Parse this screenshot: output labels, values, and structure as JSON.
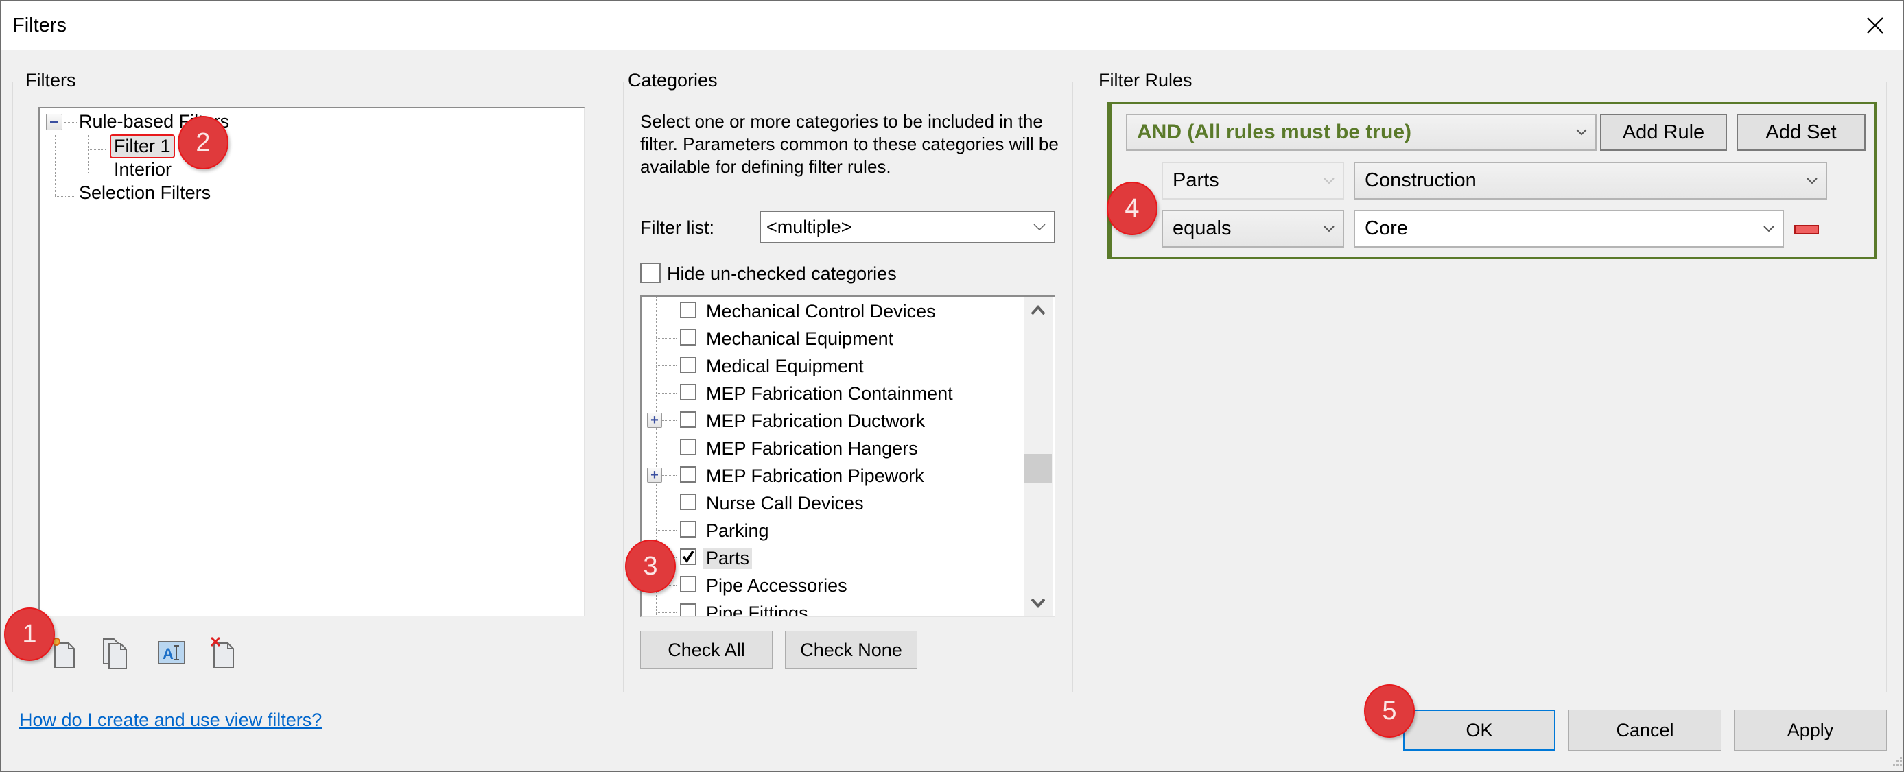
{
  "window": {
    "title": "Filters",
    "close_icon": "close-icon"
  },
  "filters_panel": {
    "label": "Filters",
    "tree": {
      "root_rule_based": "Rule-based Filters",
      "rule_children": [
        "Filter 1",
        "Interior"
      ],
      "selected": "Filter 1",
      "root_selection": "Selection Filters"
    },
    "toolbar": [
      {
        "icon": "new-filter-icon",
        "tooltip": "New"
      },
      {
        "icon": "duplicate-filter-icon",
        "tooltip": "Duplicate"
      },
      {
        "icon": "rename-filter-icon",
        "tooltip": "Rename"
      },
      {
        "icon": "delete-filter-icon",
        "tooltip": "Delete"
      }
    ]
  },
  "categories_panel": {
    "label": "Categories",
    "description": "Select one or more categories to be included in the filter.  Parameters common to these categories will be available for defining filter rules.",
    "filter_list_label": "Filter list:",
    "filter_list_value": "<multiple>",
    "hide_unchecked_label": "Hide un-checked categories",
    "hide_unchecked_checked": false,
    "items": [
      {
        "label": "Mechanical Control Devices",
        "checked": false,
        "expandable": false
      },
      {
        "label": "Mechanical Equipment",
        "checked": false,
        "expandable": false
      },
      {
        "label": "Medical Equipment",
        "checked": false,
        "expandable": false
      },
      {
        "label": "MEP Fabrication Containment",
        "checked": false,
        "expandable": false
      },
      {
        "label": "MEP Fabrication Ductwork",
        "checked": false,
        "expandable": true
      },
      {
        "label": "MEP Fabrication Hangers",
        "checked": false,
        "expandable": false
      },
      {
        "label": "MEP Fabrication Pipework",
        "checked": false,
        "expandable": true
      },
      {
        "label": "Nurse Call Devices",
        "checked": false,
        "expandable": false
      },
      {
        "label": "Parking",
        "checked": false,
        "expandable": false
      },
      {
        "label": "Parts",
        "checked": true,
        "expandable": false
      },
      {
        "label": "Pipe Accessories",
        "checked": false,
        "expandable": false
      },
      {
        "label": "Pipe Fittings",
        "checked": false,
        "expandable": false
      }
    ],
    "check_all_label": "Check All",
    "check_none_label": "Check None"
  },
  "filter_rules_panel": {
    "label": "Filter Rules",
    "logic_operator": "AND (All rules must be true)",
    "add_rule_label": "Add Rule",
    "add_set_label": "Add Set",
    "rule": {
      "category": "Parts",
      "parameter": "Construction",
      "operator": "equals",
      "value": "Core"
    },
    "accent_color": "#5a7a2a"
  },
  "footer": {
    "help_link": "How do I create and use view filters?",
    "ok_label": "OK",
    "cancel_label": "Cancel",
    "apply_label": "Apply"
  },
  "annotations": [
    "1",
    "2",
    "3",
    "4",
    "5"
  ]
}
